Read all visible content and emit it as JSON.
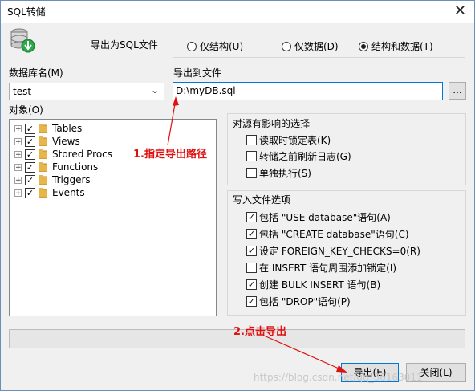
{
  "window": {
    "title": "SQL转储",
    "close_symbol": "✕"
  },
  "export_as": {
    "label": "导出为SQL文件",
    "options": [
      {
        "label": "仅结构(U)",
        "selected": false
      },
      {
        "label": "仅数据(D)",
        "selected": false
      },
      {
        "label": "结构和数据(T)",
        "selected": true
      }
    ]
  },
  "database": {
    "label": "数据库名(M)",
    "value": "test"
  },
  "export_file": {
    "label": "导出到文件",
    "value": "D:\\myDB.sql",
    "browse_label": "..."
  },
  "objects": {
    "label": "对象(O)",
    "items": [
      {
        "label": "Tables",
        "checked": true
      },
      {
        "label": "Views",
        "checked": true
      },
      {
        "label": "Stored Procs",
        "checked": true
      },
      {
        "label": "Functions",
        "checked": true
      },
      {
        "label": "Triggers",
        "checked": true
      },
      {
        "label": "Events",
        "checked": true
      }
    ]
  },
  "source_options": {
    "title": "对源有影响的选择",
    "items": [
      {
        "label": "读取时锁定表(K)",
        "checked": false
      },
      {
        "label": "转储之前刷新日志(G)",
        "checked": false
      },
      {
        "label": "单独执行(S)",
        "checked": false
      }
    ]
  },
  "write_options": {
    "title": "写入文件选项",
    "items": [
      {
        "label": "包括 \"USE database\"语句(A)",
        "checked": true
      },
      {
        "label": "包括 \"CREATE database\"语句(C)",
        "checked": true
      },
      {
        "label": "设定 FOREIGN_KEY_CHECKS=0(R)",
        "checked": true
      },
      {
        "label": "在 INSERT 语句周围添加锁定(I)",
        "checked": false
      },
      {
        "label": "创建 BULK INSERT 语句(B)",
        "checked": true
      },
      {
        "label": "包括 \"DROP\"语句(P)",
        "checked": true
      }
    ]
  },
  "buttons": {
    "export": "导出(E)",
    "close": "关闭(L)"
  },
  "annotations": {
    "step1": "1.指定导出路径",
    "step2": "2.点击导出",
    "color": "#e01010"
  },
  "watermark": "https://blog.csdn.net/qq_36163011"
}
